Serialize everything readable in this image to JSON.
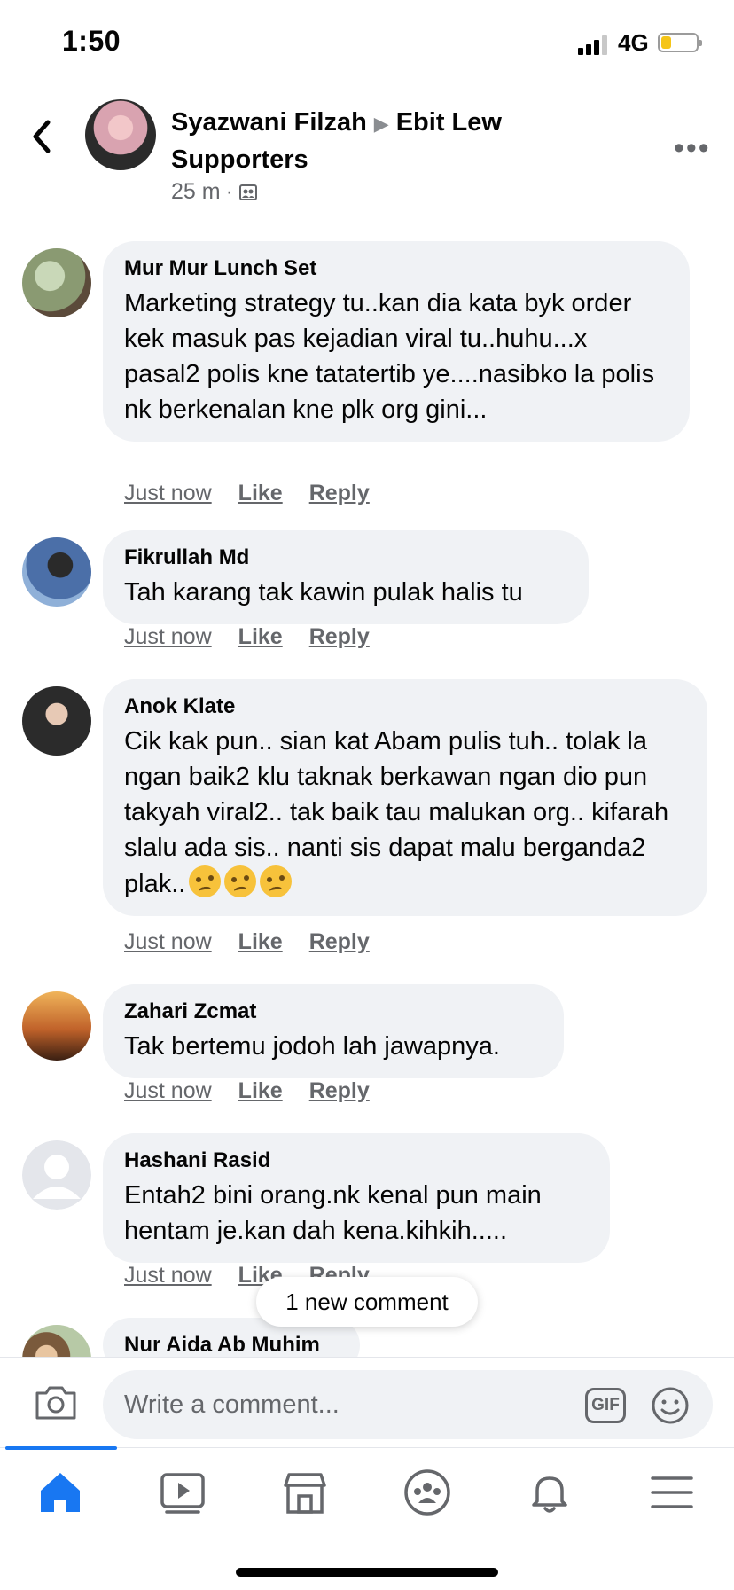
{
  "status_bar": {
    "time": "1:50",
    "network": "4G",
    "battery_level": 0.3
  },
  "header": {
    "poster": "Syazwani Filzah",
    "group": "Ebit Lew Supporters",
    "time": "25 m",
    "separator": "·",
    "avatar_colors": [
      "#f2c7c9",
      "#2b2b2b"
    ],
    "icons": {
      "back": "chevron-left-icon",
      "more": "more-dots-icon",
      "privacy": "group-icon"
    }
  },
  "comments": [
    {
      "author": "Mur Mur Lunch Set",
      "text": "Marketing strategy tu..kan dia kata byk order kek masuk pas kejadian viral tu..huhu...x pasal2 polis kne tatatertib ye....nasibko la polis nk berkenalan kne plk org gini...",
      "time": "Just now",
      "like": "Like",
      "reply": "Reply"
    },
    {
      "author": "Fikrullah Md",
      "text": "Tah karang tak kawin pulak halis tu",
      "time": "Just now",
      "like": "Like",
      "reply": "Reply"
    },
    {
      "author": "Anok Klate",
      "text": "Cik kak pun.. sian kat  Abam pulis tuh.. tolak la ngan baik2 klu taknak berkawan ngan dio pun takyah viral2.. tak baik tau malukan org.. kifarah slalu ada sis.. nanti sis dapat malu berganda2 plak..",
      "emoji_count": 3,
      "time": "Just now",
      "like": "Like",
      "reply": "Reply"
    },
    {
      "author": "Zahari Zcmat",
      "text": "Tak bertemu jodoh lah jawapnya.",
      "time": "Just now",
      "like": "Like",
      "reply": "Reply"
    },
    {
      "author": "Hashani Rasid",
      "text": "Entah2 bini orang.nk kenal pun main hentam je.kan dah kena.kihkih.....",
      "time": "Just now",
      "like": "Like",
      "reply": "Reply"
    },
    {
      "author": "Nur Aida Ab Muhim"
    }
  ],
  "new_comment_pill": "1 new comment",
  "composer": {
    "placeholder": "Write a comment...",
    "gif_label": "GIF"
  },
  "tabs": [
    "home-icon",
    "watch-icon",
    "marketplace-icon",
    "groups-icon",
    "notifications-icon",
    "menu-icon"
  ],
  "colors": {
    "accent": "#1877f2",
    "bubble": "#f0f2f5",
    "muted": "#65676b"
  }
}
